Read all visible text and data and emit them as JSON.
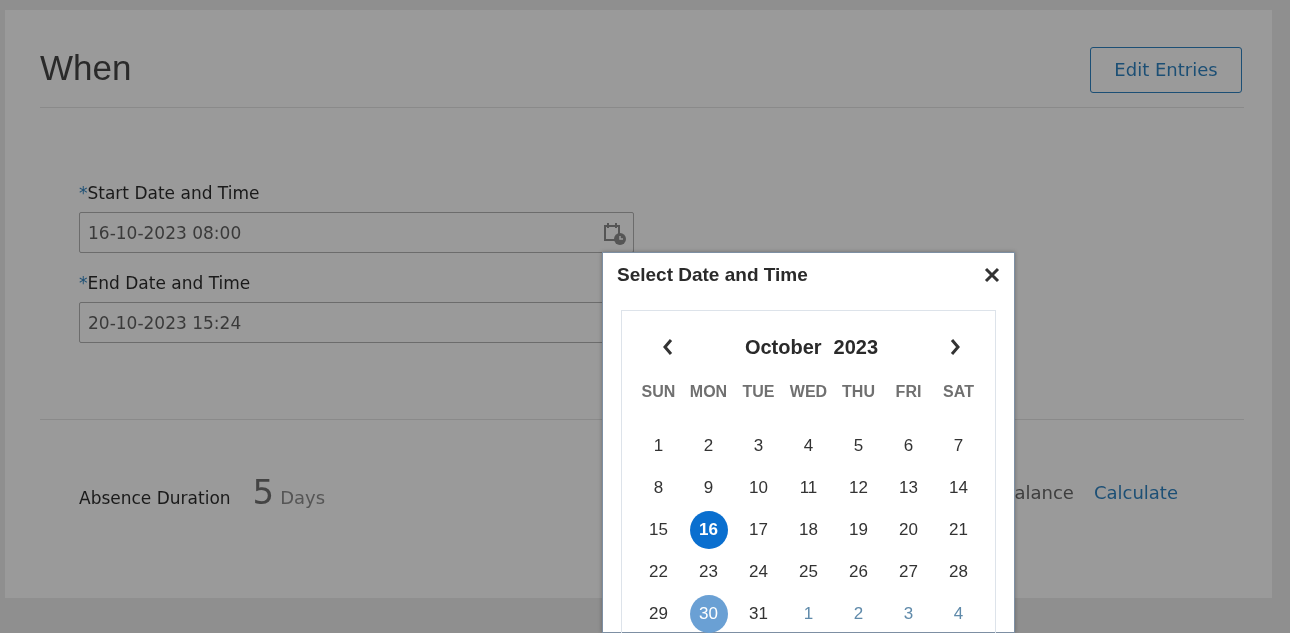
{
  "section": {
    "title": "When",
    "edit_button": "Edit Entries"
  },
  "fields": [
    {
      "required_mark": "*",
      "label": "Start Date and Time",
      "value": "16-10-2023 08:00",
      "has_picker": true
    },
    {
      "required_mark": "*",
      "label": "End Date and Time",
      "value": "20-10-2023 15:24"
    }
  ],
  "duration": {
    "label": "Absence Duration",
    "value": "5",
    "unit": "Days",
    "balance_label": "alance",
    "calculate_link": "Calculate"
  },
  "picker": {
    "title": "Select Date and Time",
    "month": "October",
    "year": "2023",
    "weekdays": [
      "SUN",
      "MON",
      "TUE",
      "WED",
      "THU",
      "FRI",
      "SAT"
    ],
    "weeks": [
      [
        {
          "label": "1",
          "selected": false,
          "today": false,
          "other_month": false
        },
        {
          "label": "2",
          "selected": false,
          "today": false,
          "other_month": false
        },
        {
          "label": "3",
          "selected": false,
          "today": false,
          "other_month": false
        },
        {
          "label": "4",
          "selected": false,
          "today": false,
          "other_month": false
        },
        {
          "label": "5",
          "selected": false,
          "today": false,
          "other_month": false
        },
        {
          "label": "6",
          "selected": false,
          "today": false,
          "other_month": false
        },
        {
          "label": "7",
          "selected": false,
          "today": false,
          "other_month": false
        }
      ],
      [
        {
          "label": "8",
          "selected": false,
          "today": false,
          "other_month": false
        },
        {
          "label": "9",
          "selected": false,
          "today": false,
          "other_month": false
        },
        {
          "label": "10",
          "selected": false,
          "today": false,
          "other_month": false
        },
        {
          "label": "11",
          "selected": false,
          "today": false,
          "other_month": false
        },
        {
          "label": "12",
          "selected": false,
          "today": false,
          "other_month": false
        },
        {
          "label": "13",
          "selected": false,
          "today": false,
          "other_month": false
        },
        {
          "label": "14",
          "selected": false,
          "today": false,
          "other_month": false
        }
      ],
      [
        {
          "label": "15",
          "selected": false,
          "today": false,
          "other_month": false
        },
        {
          "label": "16",
          "selected": true,
          "today": false,
          "other_month": false
        },
        {
          "label": "17",
          "selected": false,
          "today": false,
          "other_month": false
        },
        {
          "label": "18",
          "selected": false,
          "today": false,
          "other_month": false
        },
        {
          "label": "19",
          "selected": false,
          "today": false,
          "other_month": false
        },
        {
          "label": "20",
          "selected": false,
          "today": false,
          "other_month": false
        },
        {
          "label": "21",
          "selected": false,
          "today": false,
          "other_month": false
        }
      ],
      [
        {
          "label": "22",
          "selected": false,
          "today": false,
          "other_month": false
        },
        {
          "label": "23",
          "selected": false,
          "today": false,
          "other_month": false
        },
        {
          "label": "24",
          "selected": false,
          "today": false,
          "other_month": false
        },
        {
          "label": "25",
          "selected": false,
          "today": false,
          "other_month": false
        },
        {
          "label": "26",
          "selected": false,
          "today": false,
          "other_month": false
        },
        {
          "label": "27",
          "selected": false,
          "today": false,
          "other_month": false
        },
        {
          "label": "28",
          "selected": false,
          "today": false,
          "other_month": false
        }
      ],
      [
        {
          "label": "29",
          "selected": false,
          "today": false,
          "other_month": false
        },
        {
          "label": "30",
          "selected": false,
          "today": true,
          "other_month": false
        },
        {
          "label": "31",
          "selected": false,
          "today": false,
          "other_month": false
        },
        {
          "label": "1",
          "selected": false,
          "today": false,
          "other_month": true
        },
        {
          "label": "2",
          "selected": false,
          "today": false,
          "other_month": true
        },
        {
          "label": "3",
          "selected": false,
          "today": false,
          "other_month": true
        },
        {
          "label": "4",
          "selected": false,
          "today": false,
          "other_month": true
        }
      ]
    ]
  }
}
